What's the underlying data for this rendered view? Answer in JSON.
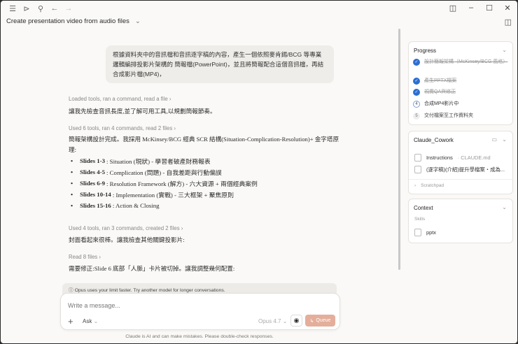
{
  "titlebar": {
    "icons": [
      "menu-icon",
      "sidebar-icon",
      "search-icon",
      "back-arrow-icon",
      "forward-arrow-icon"
    ]
  },
  "header": {
    "title": "Create presentation video from audio files"
  },
  "user_message": "根據資料夾中的音訊檔和音訊逐字稿的內容，產生一個依照麥肯錫/BCG 等專業邏輯編排投影片架構的 簡報檔(PowerPoint)，並且將簡報配合這個音訊檔，再結合成影片檔(MP4)，",
  "conversation": {
    "step1": "Loaded tools, ran a command, read a file",
    "para1": "讓我先檢查音訊長度,並了解可用工具,以規劃簡報節奏。",
    "step2": "Used 6 tools, ran 4 commands, read 2 files",
    "para2": "簡報架構設計完成。我採用 McKinsey/BCG 經典 SCR 結構(Situation-Complication-Resolution)+ 金字塔原理:",
    "slides": [
      {
        "label": "Slides 1-3",
        "text": ": Situation (現狀) - 學習者破產財務報表"
      },
      {
        "label": "Slides 4-5",
        "text": ": Complication (問題) - 自我差距與行動偏誤"
      },
      {
        "label": "Slides 6-9",
        "text": ": Resolution Framework (解方) - 六大資源 + 兩個經典案例"
      },
      {
        "label": "Slides 10-14",
        "text": ": Implementation (實戰) - 三大框架 + 聚焦原則"
      },
      {
        "label": "Slides 15-16",
        "text": ": Action & Closing"
      }
    ],
    "step3": "Used 4 tools, ran 3 commands, created 2 files",
    "para3": "封面看起來很棒。讓我檢查其他關鍵投影片:",
    "step4": "Read 8 files",
    "para4": "需要修正:Slide 6 底部「人脈」卡片被切掉。讓我調整幾何配置:"
  },
  "notice": "Opus uses your limit faster. Try another model for longer conversations.",
  "composer": {
    "placeholder": "Write a message...",
    "mode": "Ask",
    "model": "Opus 4.7",
    "queue": "Queue"
  },
  "disclaimer": "Claude is AI and can make mistakes. Please double-check responses.",
  "progress": {
    "title": "Progress",
    "items": [
      {
        "n": "✓",
        "text": "設計簡報架構（McKinsey/BCG 風格）",
        "status": "done"
      },
      {
        "n": "✓",
        "text": "產生PPTX檔案",
        "status": "done"
      },
      {
        "n": "✓",
        "text": "視覺QA與修正",
        "status": "done"
      },
      {
        "n": "4",
        "text": "合成MP4影片中",
        "status": "current"
      },
      {
        "n": "5",
        "text": "交付檔案至工作資料夾",
        "status": "todo"
      }
    ]
  },
  "folder": {
    "title": "Claude_Cowork",
    "file1_name": "Instructions",
    "file1_sub": "· CLAUDE.md",
    "file2": "(逐字稿)(介紹)提升學檔案・成為...",
    "scratchpad": "Scratchpad"
  },
  "context": {
    "title": "Context",
    "skills_label": "Skills",
    "skill": "pptx"
  }
}
